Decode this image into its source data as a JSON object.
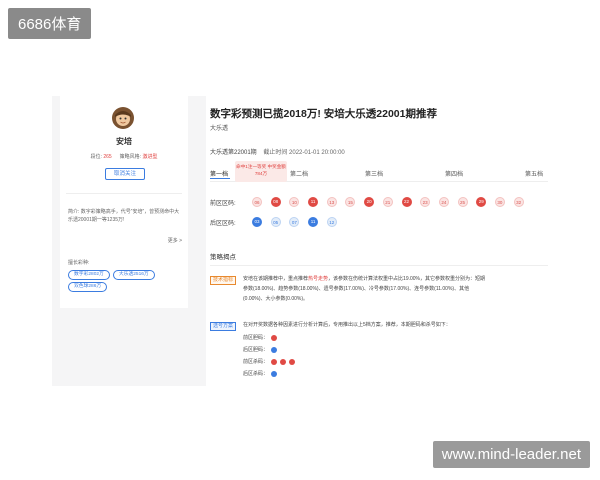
{
  "watermarks": {
    "top": "6686体育",
    "bottom": "www.mind-leader.net"
  },
  "profile": {
    "name": "安培",
    "stats": {
      "level_label": "段位:",
      "level_value": "265",
      "style_label": "策略风格:",
      "style_value": "激进型"
    },
    "follow_label": "取消关注",
    "intro": "简介: 数字彩策略高手，代号“安培”，曾预测命中大乐透20001期一等1235万!",
    "more_label": "更多 >",
    "prize_title": "擅长彩种:",
    "prizes": [
      "数字彩2802万",
      "大乐透2516万",
      "双色球286万"
    ]
  },
  "article": {
    "title": "数字彩预测已揽2018万! 安培大乐透22001期推荐",
    "author": "大乐透",
    "issue": "大乐透第22001期",
    "deadline": "截止时间 2022-01-01 20:00:00",
    "tabs": [
      "第一档",
      "第二档",
      "第三档",
      "第四档",
      "第五档"
    ],
    "tooltip": "命中1注一等奖 中奖金额784万",
    "front_label": "前区区码:",
    "back_label": "后区区码:",
    "front_balls": [
      "06",
      "08",
      "10",
      "11",
      "13",
      "15",
      "20",
      "21",
      "22",
      "23",
      "24",
      "25",
      "29",
      "30",
      "32"
    ],
    "back_balls": [
      "03",
      "05",
      "07",
      "11",
      "12"
    ],
    "section_title": "策略揭点",
    "analysis_tag": "技术指标",
    "analysis_text_1": "安培在该期推荐中，重点推荐热号走势，该参数在伤统计算法权重中占比19.00%，其它参数权重分别为：短期",
    "analysis_highlight": "热号走势",
    "analysis_text_2": "参数(18.00%)、趋势参数(18.00%)、遗号参数(17.00%)、冷号参数(17.00%)、连号参数(11.00%)、其他",
    "analysis_text_3": "(0.00%)、大小参数(0.00%)。",
    "strategy_tag": "选号方案",
    "strategy_intro": "在对开奖数据各种因素进行分析计算后，专用推出以上5档方案，推荐，本期胆码和杀号如下：",
    "strategy_lines": [
      {
        "label": "前区胆码：",
        "balls": [
          "red"
        ]
      },
      {
        "label": "后区胆码：",
        "balls": [
          "blue"
        ]
      },
      {
        "label": "前区杀码：",
        "balls": [
          "red",
          "red",
          "red"
        ]
      },
      {
        "label": "后区杀码：",
        "balls": [
          "blue"
        ]
      }
    ]
  },
  "colors": {
    "accent_blue": "#3b7ce0",
    "accent_red": "#e04a44",
    "tag_orange": "#e8892e"
  }
}
